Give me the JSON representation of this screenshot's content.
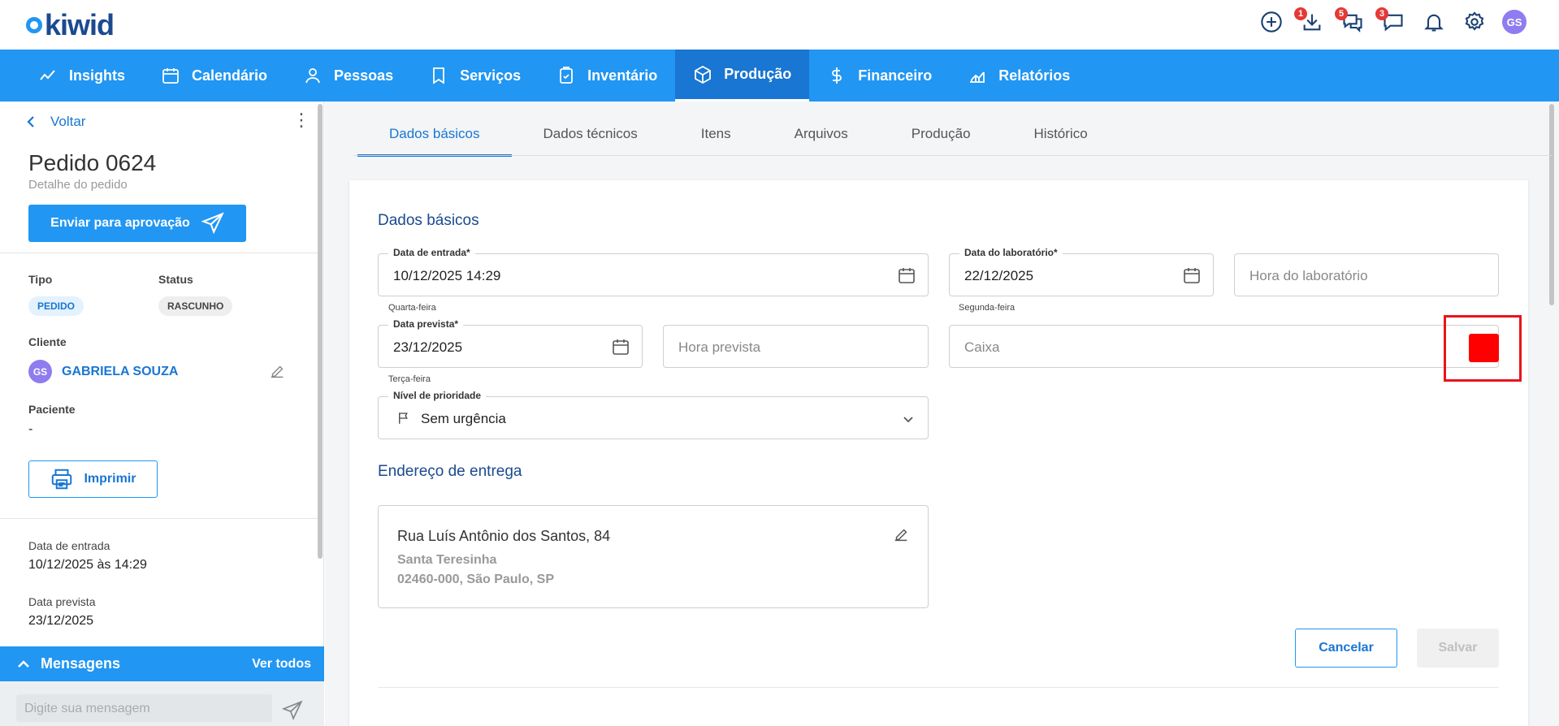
{
  "header": {
    "logo_text": "kiwid",
    "badges": {
      "downloads": "1",
      "messages": "5",
      "chat": "3"
    },
    "avatar_initials": "GS"
  },
  "nav": {
    "items": [
      {
        "label": "Insights",
        "icon": "trend-icon"
      },
      {
        "label": "Calendário",
        "icon": "calendar-icon"
      },
      {
        "label": "Pessoas",
        "icon": "person-icon"
      },
      {
        "label": "Serviços",
        "icon": "bookmark-icon"
      },
      {
        "label": "Inventário",
        "icon": "clipboard-icon"
      },
      {
        "label": "Produção",
        "icon": "box-icon",
        "active": true
      },
      {
        "label": "Financeiro",
        "icon": "dollar-icon"
      },
      {
        "label": "Relatórios",
        "icon": "chart-icon"
      }
    ]
  },
  "sidebar": {
    "back_label": "Voltar",
    "title": "Pedido 0624",
    "subtitle": "Detalhe do pedido",
    "send_button": "Enviar para aprovação",
    "type_label": "Tipo",
    "type_value": "PEDIDO",
    "status_label": "Status",
    "status_value": "RASCUNHO",
    "client_label": "Cliente",
    "client_initials": "GS",
    "client_name": "GABRIELA SOUZA",
    "patient_label": "Paciente",
    "patient_value": "-",
    "print_button": "Imprimir",
    "entry_date_label": "Data de entrada",
    "entry_date_value": "10/12/2025 às 14:29",
    "expected_date_label": "Data prevista",
    "expected_date_value": "23/12/2025"
  },
  "messages": {
    "title": "Mensagens",
    "see_all": "Ver todos",
    "placeholder": "Digite sua mensagem"
  },
  "tabs": [
    "Dados básicos",
    "Dados técnicos",
    "Itens",
    "Arquivos",
    "Produção",
    "Histórico"
  ],
  "form": {
    "section_title": "Dados básicos",
    "entry_date": {
      "label": "Data de entrada*",
      "value": "10/12/2025 14:29",
      "hint": "Quarta-feira"
    },
    "lab_date": {
      "label": "Data do laboratório*",
      "value": "22/12/2025",
      "hint": "Segunda-feira"
    },
    "lab_time": {
      "placeholder": "Hora do laboratório"
    },
    "expected_date": {
      "label": "Data prevista*",
      "value": "23/12/2025",
      "hint": "Terça-feira"
    },
    "expected_time": {
      "placeholder": "Hora prevista"
    },
    "box": {
      "placeholder": "Caixa",
      "color": "#ff0000"
    },
    "priority": {
      "label": "Nível de prioridade",
      "value": "Sem urgência"
    }
  },
  "address": {
    "section_title": "Endereço de entrega",
    "line1": "Rua Luís Antônio dos Santos, 84",
    "line2": "Santa Teresinha",
    "line3": "02460-000, São Paulo, SP"
  },
  "actions": {
    "cancel": "Cancelar",
    "save": "Salvar"
  },
  "colors": {
    "primary": "#2196f3",
    "primary_dark": "#1976d2",
    "title_blue": "#1b4a8f",
    "highlight": "#e8141c"
  }
}
